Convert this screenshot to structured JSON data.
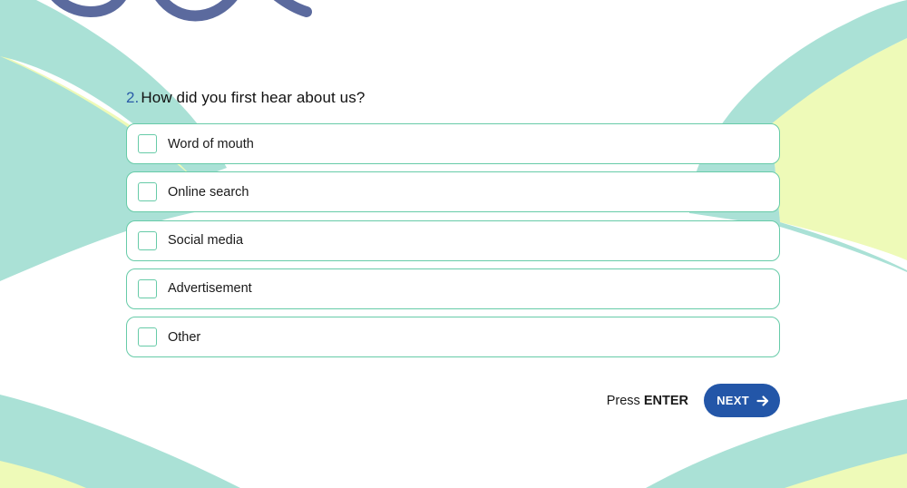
{
  "question": {
    "number": "2.",
    "text": "How did you first hear about us?"
  },
  "options": [
    {
      "label": "Word of mouth",
      "checked": false
    },
    {
      "label": "Online search",
      "checked": false
    },
    {
      "label": "Social media",
      "checked": false
    },
    {
      "label": "Advertisement",
      "checked": false
    },
    {
      "label": "Other",
      "checked": false
    }
  ],
  "footer": {
    "hint_prefix": "Press",
    "hint_key": "ENTER",
    "next_label": "NEXT",
    "next_icon": "arrow-right-icon"
  },
  "colors": {
    "accent": "#2356a8",
    "border": "#67cba8",
    "decor_mint": "#aae1d6",
    "decor_lime": "#eefab8",
    "decor_navy": "#5b6a9e"
  }
}
